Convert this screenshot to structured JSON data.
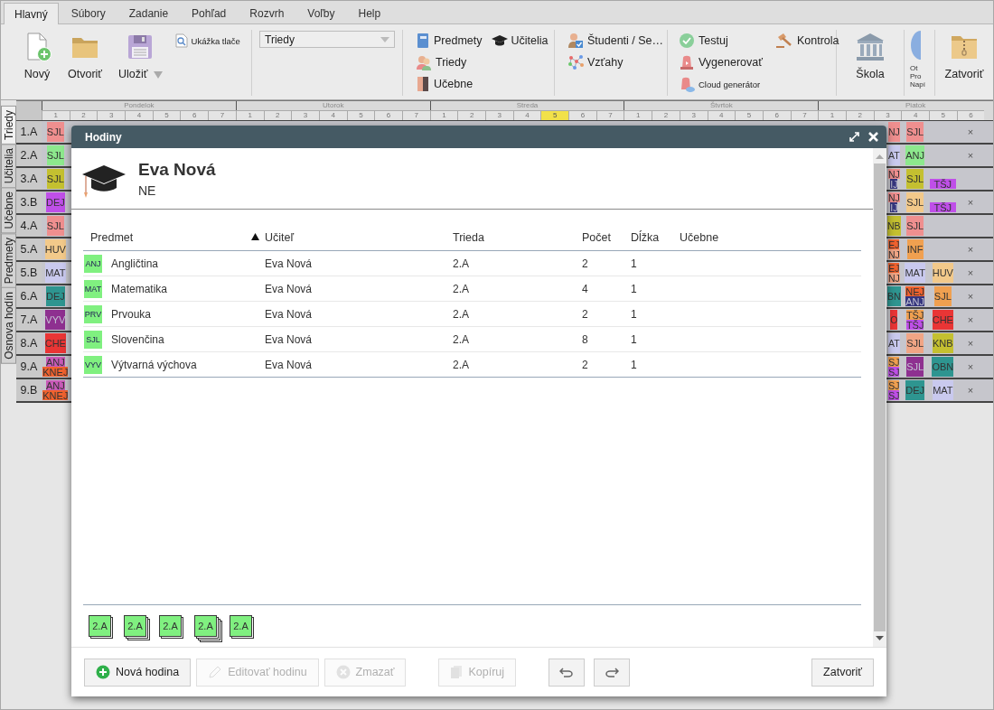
{
  "ribbon": {
    "tabs": [
      {
        "label": "Hlavný",
        "selected": true
      },
      {
        "label": "Súbory",
        "selected": false
      },
      {
        "label": "Zadanie",
        "selected": false
      },
      {
        "label": "Pohľad",
        "selected": false
      },
      {
        "label": "Rozvrh",
        "selected": false
      },
      {
        "label": "Voľby",
        "selected": false
      },
      {
        "label": "Help",
        "selected": false
      }
    ],
    "groups": [
      {
        "items": [
          {
            "kind": "large",
            "label": "Nový"
          },
          {
            "kind": "large",
            "label": "Otvoriť"
          },
          {
            "kind": "large",
            "label": "Uložiť",
            "dropdown": true
          },
          {
            "kind": "mini",
            "label": "Ukážka tlače"
          }
        ]
      },
      {
        "items": [
          {
            "kind": "combo",
            "value": "Triedy"
          }
        ]
      },
      {
        "items": [
          {
            "kind": "small",
            "label": "Predmety"
          },
          {
            "kind": "small",
            "label": "Triedy"
          },
          {
            "kind": "small",
            "label": "Učebne"
          },
          {
            "kind": "small",
            "label": "Učitelia"
          }
        ]
      },
      {
        "items": [
          {
            "kind": "small",
            "label": "Študenti / Se…"
          },
          {
            "kind": "small",
            "label": "Vzťahy"
          }
        ]
      },
      {
        "items": [
          {
            "kind": "small",
            "label": "Testuj"
          },
          {
            "kind": "small",
            "label": "Vygenerovať"
          },
          {
            "kind": "mini",
            "label": "Cloud generátor"
          },
          {
            "kind": "small",
            "label": "Kontrola"
          }
        ]
      },
      {
        "items": [
          {
            "kind": "large",
            "label": "Škola"
          }
        ]
      },
      {
        "items": [
          {
            "kind": "cut",
            "lines": [
              "Ot",
              "Pro",
              "Napí"
            ]
          }
        ]
      },
      {
        "items": [
          {
            "kind": "large",
            "label": "Zatvoriť"
          }
        ]
      }
    ]
  },
  "vertical_tabs": [
    {
      "label": "Triedy",
      "selected": true
    },
    {
      "label": "Učitelia",
      "selected": false
    },
    {
      "label": "Učebne",
      "selected": false
    },
    {
      "label": "Predmety",
      "selected": false
    },
    {
      "label": "Osnova hodín",
      "selected": false
    }
  ],
  "timetable": {
    "days": [
      {
        "name": "Pondelok",
        "periods": [
          {
            "label": "1",
            "selected": false
          },
          {
            "label": "2",
            "selected": false
          },
          {
            "label": "3",
            "selected": false
          },
          {
            "label": "4",
            "selected": false
          },
          {
            "label": "5",
            "selected": false
          },
          {
            "label": "6",
            "selected": false
          },
          {
            "label": "7",
            "selected": false
          }
        ]
      },
      {
        "name": "Utorok",
        "periods": [
          {
            "label": "1",
            "selected": false
          },
          {
            "label": "2",
            "selected": false
          },
          {
            "label": "3",
            "selected": false
          },
          {
            "label": "4",
            "selected": false
          },
          {
            "label": "5",
            "selected": false
          },
          {
            "label": "6",
            "selected": false
          },
          {
            "label": "7",
            "selected": false
          }
        ]
      },
      {
        "name": "Streda",
        "periods": [
          {
            "label": "1",
            "selected": false
          },
          {
            "label": "2",
            "selected": false
          },
          {
            "label": "3",
            "selected": false
          },
          {
            "label": "4",
            "selected": false
          },
          {
            "label": "5",
            "selected": true
          },
          {
            "label": "6",
            "selected": false
          },
          {
            "label": "7",
            "selected": false
          }
        ]
      },
      {
        "name": "Štvrtok",
        "periods": [
          {
            "label": "1",
            "selected": false
          },
          {
            "label": "2",
            "selected": false
          },
          {
            "label": "3",
            "selected": false
          },
          {
            "label": "4",
            "selected": false
          },
          {
            "label": "5",
            "selected": false
          },
          {
            "label": "6",
            "selected": false
          },
          {
            "label": "7",
            "selected": false
          }
        ]
      },
      {
        "name": "Piatok",
        "periods": [
          {
            "label": "1",
            "selected": false
          },
          {
            "label": "2",
            "selected": false
          },
          {
            "label": "3",
            "selected": false
          },
          {
            "label": "4",
            "selected": false
          },
          {
            "label": "5",
            "selected": false
          },
          {
            "label": "6",
            "selected": false
          }
        ]
      }
    ],
    "rows": [
      {
        "class": "1.A",
        "monday_first": {
          "kind": "lesson",
          "lessons": [
            {
              "code": "SJL",
              "color": "#ef8f8f"
            }
          ]
        },
        "friday": [
          {
            "kind": "lesson",
            "lessons": [
              {
                "code": "NJ",
                "color": "#ef8f8f"
              }
            ]
          },
          {
            "kind": "lesson",
            "lessons": [
              {
                "code": "SJL",
                "color": "#ef8f8f"
              }
            ]
          },
          {
            "kind": "empty"
          },
          {
            "kind": "mark",
            "text": "×"
          }
        ]
      },
      {
        "class": "2.A",
        "monday_first": {
          "kind": "lesson",
          "lessons": [
            {
              "code": "SJL",
              "color": "#8de88d"
            }
          ]
        },
        "friday": [
          {
            "kind": "lesson",
            "lessons": [
              {
                "code": "AT",
                "color": "#c9c9ee"
              }
            ]
          },
          {
            "kind": "lesson",
            "lessons": [
              {
                "code": "ANJ",
                "color": "#8de88d"
              }
            ]
          },
          {
            "kind": "empty"
          },
          {
            "kind": "mark",
            "text": "×"
          }
        ]
      },
      {
        "class": "3.A",
        "monday_first": {
          "kind": "lesson",
          "lessons": [
            {
              "code": "SJL",
              "color": "#c4c030"
            }
          ]
        },
        "friday": [
          {
            "kind": "lesson",
            "lessons": [
              {
                "code": "NJ",
                "color": "#ef8f8f"
              },
              {
                "code": "IJ",
                "color": "#35357e"
              }
            ]
          },
          {
            "kind": "lesson",
            "lessons": [
              {
                "code": "SJL",
                "color": "#c4c030"
              }
            ]
          },
          {
            "kind": "lower",
            "lessons": [
              {
                "code": "TŠJ",
                "color": "#bf4fe8"
              }
            ]
          },
          {
            "kind": "empty"
          }
        ]
      },
      {
        "class": "3.B",
        "monday_first": {
          "kind": "lesson",
          "lessons": [
            {
              "code": "DEJ",
              "color": "#bf4fe8"
            }
          ]
        },
        "friday": [
          {
            "kind": "lesson",
            "lessons": [
              {
                "code": "NJ",
                "color": "#ef8f8f"
              },
              {
                "code": "IJ",
                "color": "#35357e"
              }
            ]
          },
          {
            "kind": "lesson",
            "lessons": [
              {
                "code": "SJL",
                "color": "#f2c98a"
              }
            ]
          },
          {
            "kind": "lower",
            "lessons": [
              {
                "code": "TŠJ",
                "color": "#bf4fe8"
              }
            ]
          },
          {
            "kind": "mark",
            "text": "×"
          }
        ]
      },
      {
        "class": "4.A",
        "monday_first": {
          "kind": "lesson",
          "lessons": [
            {
              "code": "SJL",
              "color": "#ef8f8f"
            }
          ]
        },
        "friday": [
          {
            "kind": "lesson",
            "lessons": [
              {
                "code": "NB",
                "color": "#c4c030"
              }
            ]
          },
          {
            "kind": "lesson",
            "lessons": [
              {
                "code": "SJL",
                "color": "#ef8f8f"
              }
            ]
          },
          {
            "kind": "empty"
          },
          {
            "kind": "empty"
          }
        ]
      },
      {
        "class": "5.A",
        "monday_first": {
          "kind": "lesson",
          "lessons": [
            {
              "code": "HUV",
              "color": "#f2c98a"
            }
          ]
        },
        "friday": [
          {
            "kind": "lesson",
            "lessons": [
              {
                "code": "EJ",
                "color": "#f0622e"
              },
              {
                "code": "NJ",
                "color": "#f0a585"
              }
            ]
          },
          {
            "kind": "lesson",
            "lessons": [
              {
                "code": "INF",
                "color": "#f0a050"
              }
            ]
          },
          {
            "kind": "empty"
          },
          {
            "kind": "mark",
            "text": "×"
          }
        ]
      },
      {
        "class": "5.B",
        "monday_first": {
          "kind": "lesson",
          "lessons": [
            {
              "code": "MAT",
              "color": "#c9c9ee"
            }
          ]
        },
        "friday": [
          {
            "kind": "lesson",
            "lessons": [
              {
                "code": "EJ",
                "color": "#f0622e"
              },
              {
                "code": "NJ",
                "color": "#f0a585"
              }
            ]
          },
          {
            "kind": "lesson",
            "lessons": [
              {
                "code": "MAT",
                "color": "#c9c9ee"
              }
            ]
          },
          {
            "kind": "lesson",
            "lessons": [
              {
                "code": "HUV",
                "color": "#f2c98a"
              }
            ]
          },
          {
            "kind": "mark",
            "text": "×"
          }
        ]
      },
      {
        "class": "6.A",
        "monday_first": {
          "kind": "lesson",
          "lessons": [
            {
              "code": "DEJ",
              "color": "#2e9590"
            }
          ]
        },
        "friday": [
          {
            "kind": "lesson",
            "lessons": [
              {
                "code": "BN",
                "color": "#2e9590"
              }
            ]
          },
          {
            "kind": "lesson",
            "lessons": [
              {
                "code": "NEJ",
                "color": "#f0622e"
              },
              {
                "code": "ANJ",
                "color": "#35357e"
              }
            ]
          },
          {
            "kind": "lesson",
            "lessons": [
              {
                "code": "SJL",
                "color": "#f0a050"
              }
            ]
          },
          {
            "kind": "mark",
            "text": "×"
          }
        ]
      },
      {
        "class": "7.A",
        "monday_first": {
          "kind": "lesson",
          "lessons": [
            {
              "code": "VYV",
              "color": "#8e3090"
            }
          ]
        },
        "friday": [
          {
            "kind": "lesson",
            "lessons": [
              {
                "code": "O",
                "color": "#e93535"
              }
            ]
          },
          {
            "kind": "lesson",
            "lessons": [
              {
                "code": "TŠJ",
                "color": "#f0a050"
              },
              {
                "code": "TŠJ",
                "color": "#bf4fe8"
              }
            ]
          },
          {
            "kind": "lesson",
            "lessons": [
              {
                "code": "CHE",
                "color": "#e93535"
              }
            ]
          },
          {
            "kind": "mark",
            "text": "×"
          }
        ]
      },
      {
        "class": "8.A",
        "monday_first": {
          "kind": "lesson",
          "lessons": [
            {
              "code": "CHE",
              "color": "#e93535"
            }
          ]
        },
        "friday": [
          {
            "kind": "lesson",
            "lessons": [
              {
                "code": "AT",
                "color": "#c9c9ee"
              }
            ]
          },
          {
            "kind": "lesson",
            "lessons": [
              {
                "code": "SJL",
                "color": "#f0a585"
              }
            ]
          },
          {
            "kind": "lesson",
            "lessons": [
              {
                "code": "KNB",
                "color": "#c4c030"
              }
            ]
          },
          {
            "kind": "mark",
            "text": "×"
          }
        ]
      },
      {
        "class": "9.A",
        "monday_first": {
          "kind": "lesson",
          "lessons": [
            {
              "code": "ANJ",
              "color": "#c85ab8"
            },
            {
              "code": "KNEJ",
              "color": "#f0622e"
            }
          ]
        },
        "friday": [
          {
            "kind": "lesson",
            "lessons": [
              {
                "code": "SJ",
                "color": "#f0a050"
              },
              {
                "code": "SJ",
                "color": "#bf4fe8"
              }
            ]
          },
          {
            "kind": "lesson",
            "lessons": [
              {
                "code": "SJL",
                "color": "#8e3090"
              }
            ]
          },
          {
            "kind": "lesson",
            "lessons": [
              {
                "code": "OBN",
                "color": "#2e9590"
              }
            ]
          },
          {
            "kind": "mark",
            "text": "×"
          }
        ]
      },
      {
        "class": "9.B",
        "monday_first": {
          "kind": "lesson",
          "lessons": [
            {
              "code": "ANJ",
              "color": "#c85ab8"
            },
            {
              "code": "KNEJ",
              "color": "#f0622e"
            }
          ]
        },
        "friday": [
          {
            "kind": "lesson",
            "lessons": [
              {
                "code": "SJ",
                "color": "#f0a050"
              },
              {
                "code": "SJ",
                "color": "#bf4fe8"
              }
            ]
          },
          {
            "kind": "lesson",
            "lessons": [
              {
                "code": "DEJ",
                "color": "#2e9590"
              }
            ]
          },
          {
            "kind": "lesson",
            "lessons": [
              {
                "code": "MAT",
                "color": "#c9c9ee"
              }
            ]
          },
          {
            "kind": "mark",
            "text": "×"
          }
        ]
      }
    ]
  },
  "dialog": {
    "title": "Hodiny",
    "teacher": {
      "name": "Eva Nová",
      "short": "NE"
    },
    "table": {
      "columns": [
        {
          "label": "Predmet",
          "sorted": false
        },
        {
          "label": "Učiteľ",
          "sorted": true
        },
        {
          "label": "Trieda",
          "sorted": false
        },
        {
          "label": "Počet",
          "sorted": false
        },
        {
          "label": "Dĺžka",
          "sorted": false
        },
        {
          "label": "Učebne",
          "sorted": false
        }
      ],
      "rows": [
        {
          "code": "ANJ",
          "subject": "Angličtina",
          "teacher": "Eva Nová",
          "class": "2.A",
          "count": "2",
          "length": "1"
        },
        {
          "code": "MAT",
          "subject": "Matematika",
          "teacher": "Eva Nová",
          "class": "2.A",
          "count": "4",
          "length": "1"
        },
        {
          "code": "PRV",
          "subject": "Prvouka",
          "teacher": "Eva Nová",
          "class": "2.A",
          "count": "2",
          "length": "1"
        },
        {
          "code": "SJL",
          "subject": "Slovenčina",
          "teacher": "Eva Nová",
          "class": "2.A",
          "count": "8",
          "length": "1"
        },
        {
          "code": "VYV",
          "subject": "Výtvarná výchova",
          "teacher": "Eva Nová",
          "class": "2.A",
          "count": "2",
          "length": "1"
        }
      ]
    },
    "cards": [
      {
        "label": "2.A",
        "kind": "single"
      },
      {
        "label": "2.A",
        "kind": "double"
      },
      {
        "label": "2.A",
        "kind": "single"
      },
      {
        "label": "2.A",
        "kind": "multi"
      },
      {
        "label": "2.A",
        "kind": "single"
      }
    ],
    "buttons": [
      {
        "kind": "add",
        "label": "Nová hodina",
        "disabled": false
      },
      {
        "kind": "edit",
        "label": "Editovať hodinu",
        "disabled": true
      },
      {
        "kind": "delete",
        "label": "Zmazať",
        "disabled": true
      },
      {
        "kind": "copy",
        "label": "Kopíruj",
        "disabled": true
      },
      {
        "kind": "undo",
        "disabled": false
      },
      {
        "kind": "redo",
        "disabled": false
      },
      {
        "kind": "close",
        "label": "Zatvoriť",
        "disabled": false
      }
    ]
  }
}
